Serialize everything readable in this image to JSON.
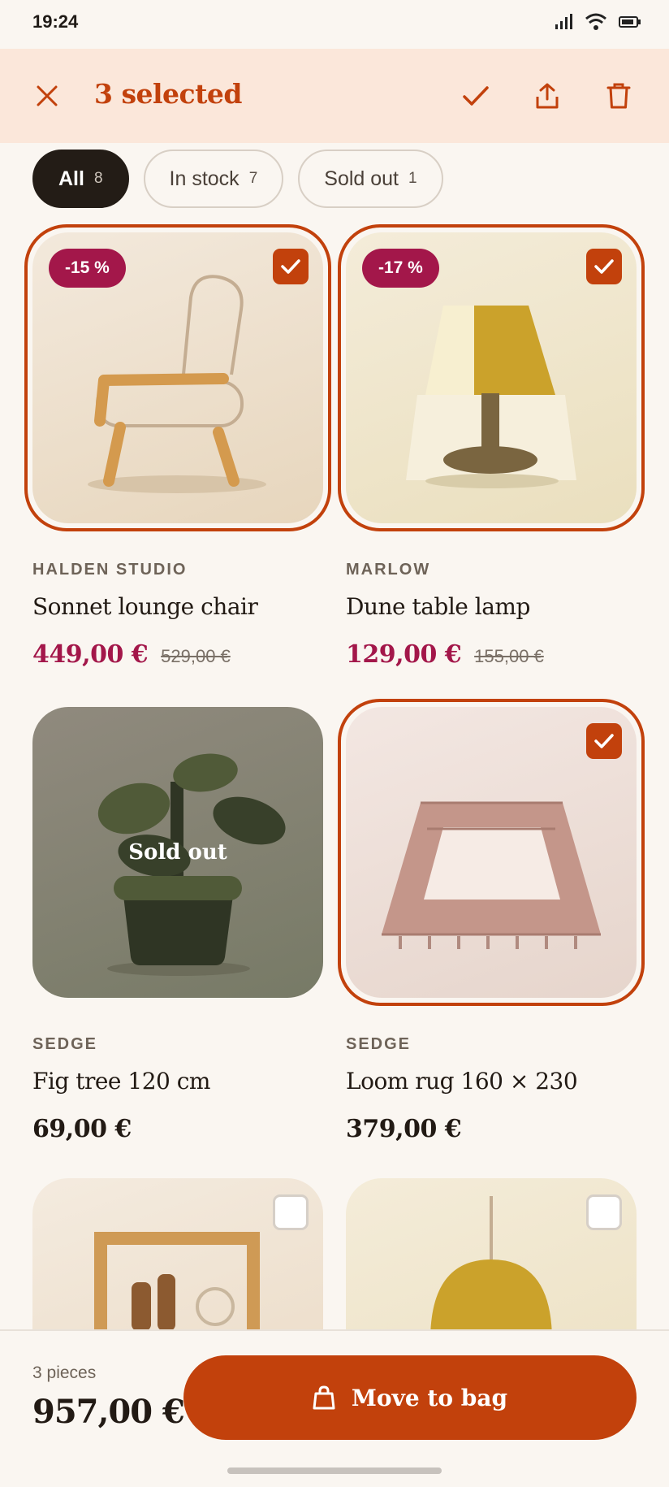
{
  "status": {
    "time": "19:24"
  },
  "selection": {
    "title": "3 selected"
  },
  "filters": [
    {
      "label": "All",
      "count": "8"
    },
    {
      "label": "In stock",
      "count": "7"
    },
    {
      "label": "Sold out",
      "count": "1"
    }
  ],
  "products": [
    {
      "brand": "HALDEN STUDIO",
      "name": "Sonnet lounge chair",
      "price": "449,00 €",
      "old_price": "529,00 €",
      "badge": "-15 %",
      "selected": true
    },
    {
      "brand": "MARLOW",
      "name": "Dune table lamp",
      "price": "129,00 €",
      "old_price": "155,00 €",
      "badge": "-17 %",
      "selected": true
    },
    {
      "brand": "SEDGE",
      "name": "Fig tree 120 cm",
      "price": "69,00 €",
      "status": "Sold out",
      "selected": false
    },
    {
      "brand": "SEDGE",
      "name": "Loom rug 160 × 230",
      "price": "379,00 €",
      "selected": true
    },
    {
      "selected": false
    },
    {
      "selected": false
    }
  ],
  "footer": {
    "pieces": "3 pieces",
    "total": "957,00 €",
    "cta": "Move to bag"
  },
  "colors": {
    "accent": "#c2410c",
    "sale": "#a3174a",
    "selection_bar": "#fbe7da"
  }
}
